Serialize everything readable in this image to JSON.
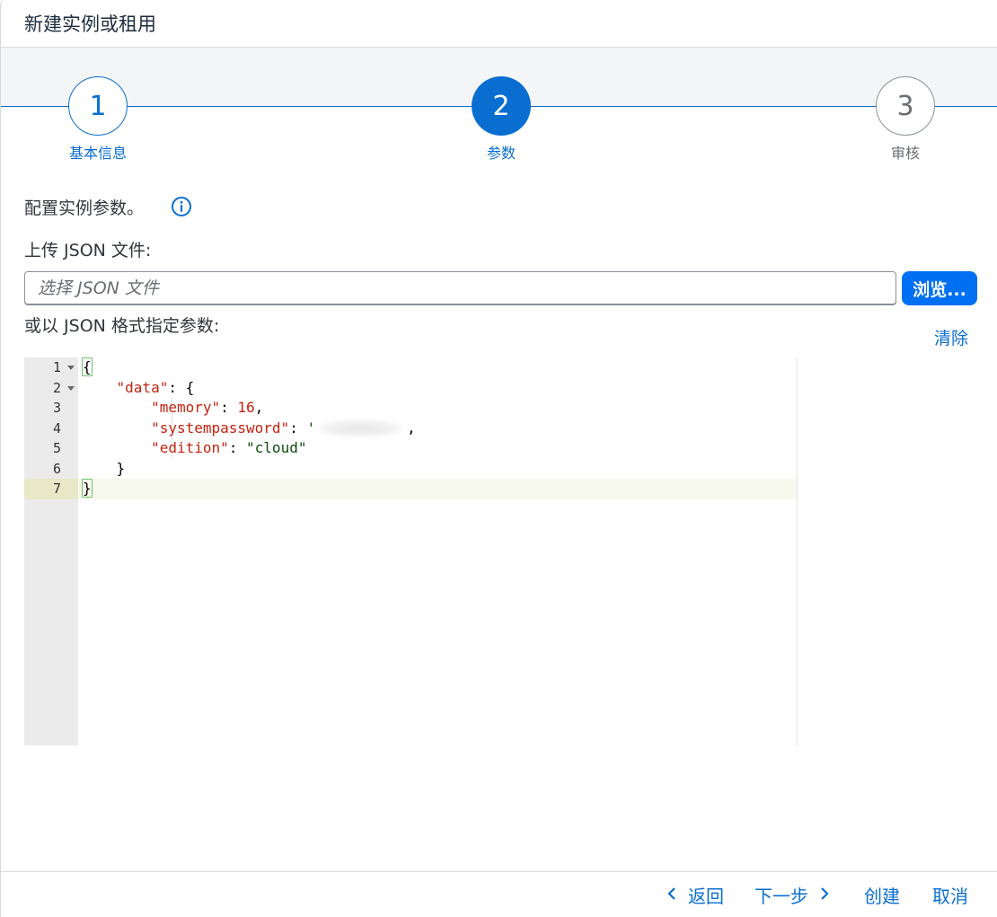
{
  "dialog": {
    "title": "新建实例或租用"
  },
  "wizard": {
    "steps": [
      {
        "number": "1",
        "label": "基本信息",
        "state": "completed"
      },
      {
        "number": "2",
        "label": "参数",
        "state": "active"
      },
      {
        "number": "3",
        "label": "审核",
        "state": "pending"
      }
    ]
  },
  "content": {
    "description": "配置实例参数。",
    "info_icon": "info-circle-icon",
    "upload_label": "上传 JSON 文件:",
    "file_placeholder": "选择 JSON 文件",
    "browse_label": "浏览...",
    "json_label": "或以 JSON 格式指定参数:",
    "clear_label": "清除"
  },
  "editor": {
    "line_numbers": [
      "1",
      "2",
      "3",
      "4",
      "5",
      "6",
      "7"
    ],
    "lines": [
      {
        "open_brace": "{"
      },
      {
        "indent": "    ",
        "key": "\"data\"",
        "rest": ": {"
      },
      {
        "indent": "        ",
        "key": "\"memory\"",
        "sep": ": ",
        "value": "16",
        "tail": ","
      },
      {
        "indent": "        ",
        "key": "\"systempassword\"",
        "sep": ": ",
        "value_start": "'",
        "tail": ","
      },
      {
        "indent": "        ",
        "key": "\"edition\"",
        "sep": ": ",
        "value": "\"cloud\""
      },
      {
        "indent": "    ",
        "close": "}"
      },
      {
        "close_brace": "}"
      }
    ]
  },
  "footer": {
    "back_label": "返回",
    "next_label": "下一步",
    "create_label": "创建",
    "cancel_label": "取消"
  },
  "colors": {
    "accent": "#0a6ed1",
    "button_blue": "#0070f2",
    "json_key": "#c5220f",
    "json_string": "#0b4d0b"
  }
}
